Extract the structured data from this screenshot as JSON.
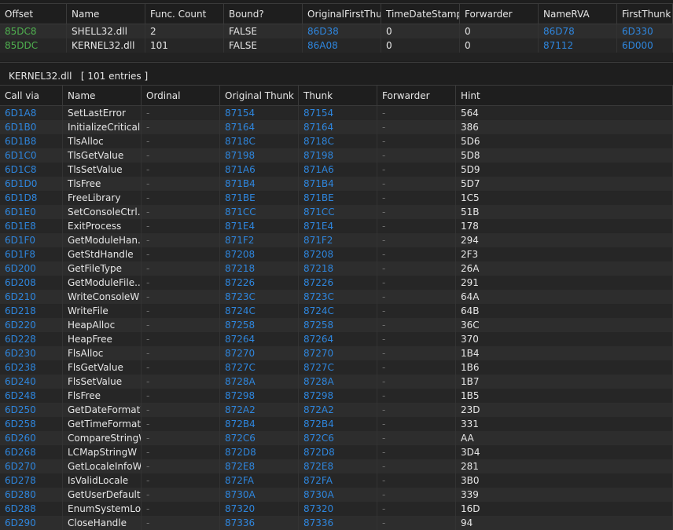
{
  "top_table": {
    "columns": [
      "Offset",
      "Name",
      "Func. Count",
      "Bound?",
      "OriginalFirstThun",
      "TimeDateStamp",
      "Forwarder",
      "NameRVA",
      "FirstThunk"
    ],
    "rows": [
      [
        "85DC8",
        "SHELL32.dll",
        "2",
        "FALSE",
        "86D38",
        "0",
        "0",
        "86D78",
        "6D330"
      ],
      [
        "85DDC",
        "KERNEL32.dll",
        "101",
        "FALSE",
        "86A08",
        "0",
        "0",
        "87112",
        "6D000"
      ]
    ]
  },
  "section": {
    "dll": "KERNEL32.dll",
    "entries": "[ 101 entries ]"
  },
  "bottom_table": {
    "columns": [
      "Call via",
      "Name",
      "Ordinal",
      "Original Thunk",
      "Thunk",
      "Forwarder",
      "Hint"
    ],
    "rows": [
      [
        "6D1A8",
        "SetLastError",
        "-",
        "87154",
        "87154",
        "-",
        "564"
      ],
      [
        "6D1B0",
        "InitializeCritical...",
        "-",
        "87164",
        "87164",
        "-",
        "386"
      ],
      [
        "6D1B8",
        "TlsAlloc",
        "-",
        "8718C",
        "8718C",
        "-",
        "5D6"
      ],
      [
        "6D1C0",
        "TlsGetValue",
        "-",
        "87198",
        "87198",
        "-",
        "5D8"
      ],
      [
        "6D1C8",
        "TlsSetValue",
        "-",
        "871A6",
        "871A6",
        "-",
        "5D9"
      ],
      [
        "6D1D0",
        "TlsFree",
        "-",
        "871B4",
        "871B4",
        "-",
        "5D7"
      ],
      [
        "6D1D8",
        "FreeLibrary",
        "-",
        "871BE",
        "871BE",
        "-",
        "1C5"
      ],
      [
        "6D1E0",
        "SetConsoleCtrl...",
        "-",
        "871CC",
        "871CC",
        "-",
        "51B"
      ],
      [
        "6D1E8",
        "ExitProcess",
        "-",
        "871E4",
        "871E4",
        "-",
        "178"
      ],
      [
        "6D1F0",
        "GetModuleHan...",
        "-",
        "871F2",
        "871F2",
        "-",
        "294"
      ],
      [
        "6D1F8",
        "GetStdHandle",
        "-",
        "87208",
        "87208",
        "-",
        "2F3"
      ],
      [
        "6D200",
        "GetFileType",
        "-",
        "87218",
        "87218",
        "-",
        "26A"
      ],
      [
        "6D208",
        "GetModuleFile...",
        "-",
        "87226",
        "87226",
        "-",
        "291"
      ],
      [
        "6D210",
        "WriteConsoleW",
        "-",
        "8723C",
        "8723C",
        "-",
        "64A"
      ],
      [
        "6D218",
        "WriteFile",
        "-",
        "8724C",
        "8724C",
        "-",
        "64B"
      ],
      [
        "6D220",
        "HeapAlloc",
        "-",
        "87258",
        "87258",
        "-",
        "36C"
      ],
      [
        "6D228",
        "HeapFree",
        "-",
        "87264",
        "87264",
        "-",
        "370"
      ],
      [
        "6D230",
        "FlsAlloc",
        "-",
        "87270",
        "87270",
        "-",
        "1B4"
      ],
      [
        "6D238",
        "FlsGetValue",
        "-",
        "8727C",
        "8727C",
        "-",
        "1B6"
      ],
      [
        "6D240",
        "FlsSetValue",
        "-",
        "8728A",
        "8728A",
        "-",
        "1B7"
      ],
      [
        "6D248",
        "FlsFree",
        "-",
        "87298",
        "87298",
        "-",
        "1B5"
      ],
      [
        "6D250",
        "GetDateFormatW",
        "-",
        "872A2",
        "872A2",
        "-",
        "23D"
      ],
      [
        "6D258",
        "GetTimeFormatW",
        "-",
        "872B4",
        "872B4",
        "-",
        "331"
      ],
      [
        "6D260",
        "CompareStringW",
        "-",
        "872C6",
        "872C6",
        "-",
        "AA"
      ],
      [
        "6D268",
        "LCMapStringW",
        "-",
        "872D8",
        "872D8",
        "-",
        "3D4"
      ],
      [
        "6D270",
        "GetLocaleInfoW",
        "-",
        "872E8",
        "872E8",
        "-",
        "281"
      ],
      [
        "6D278",
        "IsValidLocale",
        "-",
        "872FA",
        "872FA",
        "-",
        "3B0"
      ],
      [
        "6D280",
        "GetUserDefault...",
        "-",
        "8730A",
        "8730A",
        "-",
        "339"
      ],
      [
        "6D288",
        "EnumSystemLo...",
        "-",
        "87320",
        "87320",
        "-",
        "16D"
      ],
      [
        "6D290",
        "CloseHandle",
        "-",
        "87336",
        "87336",
        "-",
        "94"
      ]
    ]
  },
  "colors": {
    "address": "#2e86de",
    "offset": "#4fb04f",
    "background": "#1e1e1e"
  }
}
